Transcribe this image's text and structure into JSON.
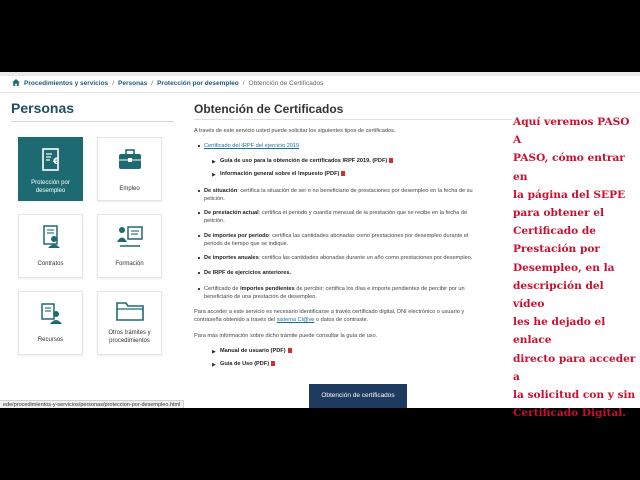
{
  "breadcrumb": {
    "items": [
      "Procedimientos y servicios",
      "Personas",
      "Protección por desempleo"
    ],
    "current": "Obtención de Certificados"
  },
  "sidebar": {
    "title": "Personas",
    "tiles": [
      {
        "label": "Protección por desempleo",
        "icon": "document-euro-icon",
        "active": true
      },
      {
        "label": "Empleo",
        "icon": "briefcase-icon",
        "active": false
      },
      {
        "label": "Contratos",
        "icon": "contract-person-icon",
        "active": false
      },
      {
        "label": "Formación",
        "icon": "training-board-icon",
        "active": false
      },
      {
        "label": "Recursos",
        "icon": "resources-person-icon",
        "active": false
      },
      {
        "label": "Otros trámites y procedimientos",
        "icon": "folder-icon",
        "active": false
      }
    ]
  },
  "main": {
    "title": "Obtención de Certificados",
    "intro": "A través de este servicio usted puede solicitar los siguientes tipos de certificados.",
    "irpf_link": "Certificado del IRPF del ejercicio 2019",
    "irpf_sub1": "Guía de uso para la obtención de certificados IRPF 2019. (PDF)",
    "irpf_sub2": "Información general sobre el Impuesto (PDF)",
    "b1_term": "De situación",
    "b1_l1": ": certifica la situación de ser o no beneficiario de prestaciones por desempleo en la fecha de su",
    "b1_l2": "petición.",
    "b2_term": "De prestación actual",
    "b2_l1": ": certifica el periodo y cuantía mensual de la prestación que se recibe en la fecha de",
    "b2_l2": "petición.",
    "b3_term": "De importes por periodo",
    "b3_l1": ": certifica las cantidades abonadas como prestaciones por desempleo durante el",
    "b3_l2": "periodo de tiempo que se indique.",
    "b4_term": "De importes anuales",
    "b4_l1": ": certifica las cantidades abonadas durante un año como prestaciones por desempleo.",
    "b5": "De IRPF de ejercicios anteriores.",
    "b6_pre": "Certificado de ",
    "b6_term": "importes pendientes",
    "b6_l1": " de percibir: certifica los días e importe pendientes de percibir por un",
    "b6_l2": "beneficiario de una prestación de desempleo.",
    "access_l1": "Para acceder a este servicio es necesario identificarse a través certificado digital, DNI electrónico o usuario y",
    "access_l2_pre": "contraseña obtenido a través del ",
    "access_link": "sistema Cl@ve",
    "access_l2_post": " o datos de contraste.",
    "guide_intro": "Para más información sobre dicho trámite puede consultar la guía de uso.",
    "guide1": "Manual de usuario (PDF)",
    "guide2": "Guía de Uso (PDF)",
    "cta": "Obtención de certificados"
  },
  "statusbar": "ede/procedimientos-y-servicios/personas/proteccion-por-desempleo.html",
  "overlay": {
    "lines": [
      "Aquí veremos PASO A",
      "PASO, cómo entrar en",
      "la página del SEPE",
      "para obtener el",
      "Certificado de",
      "Prestación por",
      "Desempleo, en la",
      "descripción del vídeo",
      "les he dejado el enlace",
      "directo para acceder a",
      "la solicitud con y sin",
      "Certificado Digital."
    ]
  },
  "colors": {
    "accent": "#1e6a72",
    "cta": "#1e3a5f",
    "overlay_text": "#c8102e",
    "pdf_icon": "#d32f2f"
  }
}
